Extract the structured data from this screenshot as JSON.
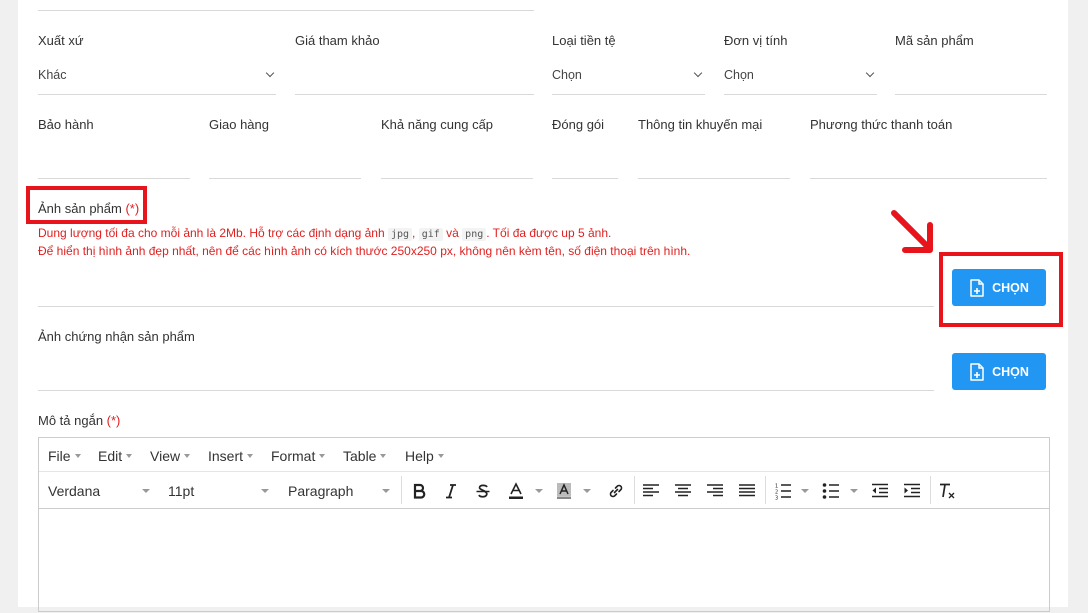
{
  "fields_row1": [
    {
      "label": "Xuất xứ",
      "value": "Khác"
    },
    {
      "label": "Giá tham khảo",
      "value": ""
    },
    {
      "label": "Loại tiền tệ",
      "value": "Chọn"
    },
    {
      "label": "Đơn vị tính",
      "value": "Chọn"
    },
    {
      "label": "Mã sản phẩm",
      "value": ""
    }
  ],
  "fields_row2": [
    {
      "label": "Bảo hành"
    },
    {
      "label": "Giao hàng"
    },
    {
      "label": "Khả năng cung cấp"
    },
    {
      "label": "Đóng gói"
    },
    {
      "label": "Thông tin khuyến mại"
    },
    {
      "label": "Phương thức thanh toán"
    }
  ],
  "product_image": {
    "label": "Ảnh sản phẩm",
    "required_mark": "(*)",
    "hint1_a": "Dung lượng tối đa cho mỗi ảnh là 2Mb. Hỗ trợ các định dạng ảnh",
    "fmt1": "jpg",
    "hint1_b": ",",
    "fmt2": "gif",
    "hint1_c": "và",
    "fmt3": "png",
    "hint1_d": ". Tối đa được up 5 ảnh.",
    "hint2": "Để hiển thị hình ảnh đẹp nhất, nên để các hình ảnh có kích thước 250x250 px, không nên kèm tên, số điện thoại trên hình.",
    "button_label": "CHỌN"
  },
  "certificate_image": {
    "label": "Ảnh chứng nhận sản phẩm",
    "button_label": "CHỌN"
  },
  "short_description": {
    "label": "Mô tả ngắn",
    "required_mark": "(*)"
  },
  "editor": {
    "menus": [
      "File",
      "Edit",
      "View",
      "Insert",
      "Format",
      "Table",
      "Help"
    ],
    "font_family": "Verdana",
    "font_size": "11pt",
    "block_format": "Paragraph"
  },
  "colors": {
    "accent": "#2196f3",
    "highlight": "#e8141b",
    "required": "#e02020"
  }
}
